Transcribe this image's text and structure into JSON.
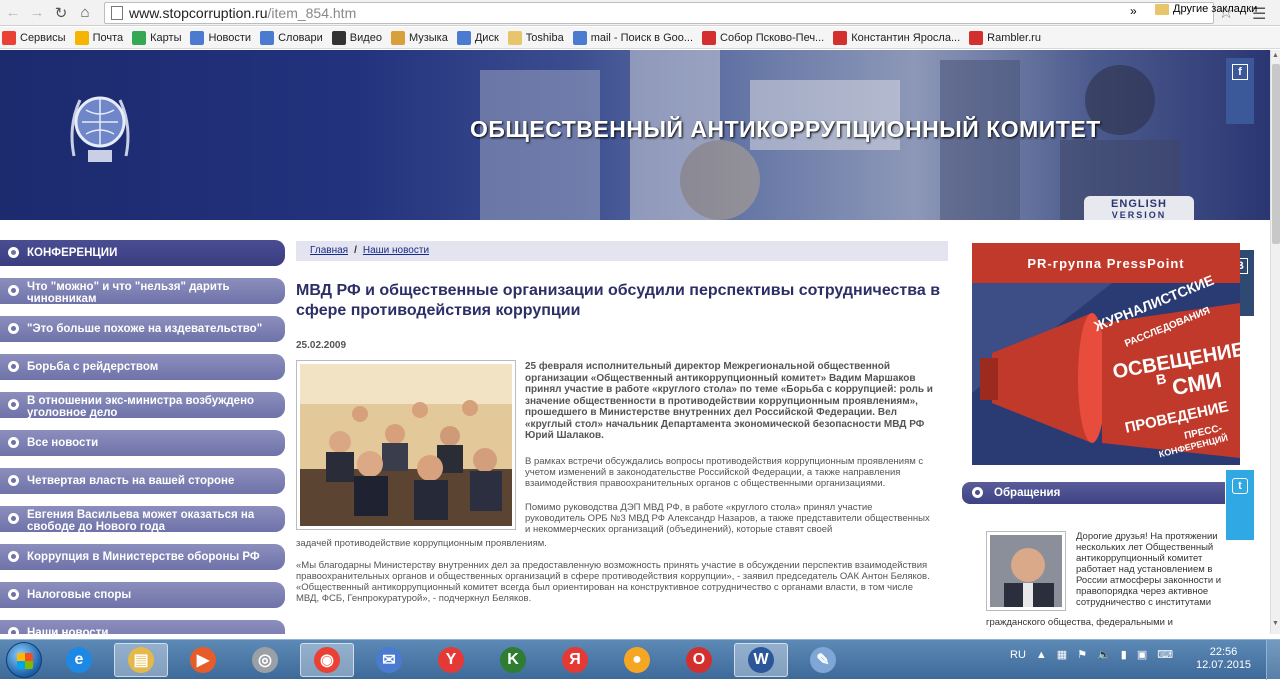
{
  "browser": {
    "url_host": "www.stopcorruption.ru",
    "url_path": "/item_854.htm",
    "bookmarks": [
      {
        "label": "Сервисы",
        "color": "#e94235"
      },
      {
        "label": "Почта",
        "color": "#f4b400"
      },
      {
        "label": "Карты",
        "color": "#34a853"
      },
      {
        "label": "Новости",
        "color": "#4a7bd0"
      },
      {
        "label": "Словари",
        "color": "#4a7bd0"
      },
      {
        "label": "Видео",
        "color": "#333333"
      },
      {
        "label": "Музыка",
        "color": "#d8a03a"
      },
      {
        "label": "Диск",
        "color": "#4a7bd0"
      },
      {
        "label": "Toshiba",
        "color": "#e8c46a"
      },
      {
        "label": "mail - Поиск в Goo...",
        "color": "#4a7bd0"
      },
      {
        "label": "Собор Псково-Печ...",
        "color": "#d32f2f"
      },
      {
        "label": "Константин Яросла...",
        "color": "#d32f2f"
      },
      {
        "label": "Rambler.ru",
        "color": "#d32f2f"
      }
    ],
    "bookmarks_more": "»",
    "bookmarks_other": "Другие закладки"
  },
  "header": {
    "title": "ОБЩЕСТВЕННЫЙ АНТИКОРРУПЦИОННЫЙ КОМИТЕТ",
    "english_line1": "ENGLISH",
    "english_line2": "VERSION",
    "social": {
      "facebook": "f",
      "vk": "B",
      "twitter": "t"
    }
  },
  "sidebar": {
    "items": [
      {
        "label": "КОНФЕРЕНЦИИ",
        "active": true
      },
      {
        "label": "Что \"можно\" и что \"нельзя\" дарить чиновникам",
        "active": false
      },
      {
        "label": "\"Это больше похоже на издевательство\"",
        "active": false
      },
      {
        "label": "Борьба с рейдерством",
        "active": false
      },
      {
        "label": "В отношении экс-министра возбуждено уголовное дело",
        "active": false
      },
      {
        "label": "Все новости",
        "active": false
      },
      {
        "label": "Четвертая власть на вашей стороне",
        "active": false
      },
      {
        "label": "Евгения Васильева может оказаться на свободе до Нового года",
        "active": false
      },
      {
        "label": "Коррупция в Министерстве обороны РФ",
        "active": false
      },
      {
        "label": "Налоговые споры",
        "active": false
      },
      {
        "label": "Наши новости",
        "active": false
      }
    ]
  },
  "article": {
    "breadcrumb_home": "Главная",
    "breadcrumb_sep": "/",
    "breadcrumb_current": "Наши новости",
    "title": "МВД РФ и общественные организации обсудили перспективы сотрудничества в сфере противодействия коррупции",
    "date": "25.02.2009",
    "lead": "25 февраля исполнительный директор Межрегиональной общественной организации «Общественный антикоррупционный комитет» Вадим Маршаков принял участие в работе «круглого стола» по теме «Борьба с коррупцией: роль и значение общественности в противодействии коррупционным проявлениям», прошедшего в Министерстве внутренних дел Российской Федерации. Вел «круглый стол» начальник Департамента экономической безопасности МВД РФ Юрий Шалаков.",
    "p1": "В рамках встречи обсуждались вопросы противодействия коррупционным проявлениям с учетом изменений в законодательстве Российской Федерации, а также направления взаимодействия правоохранительных органов с общественными организациями.",
    "p2a": "Помимо руководства ДЭП МВД РФ, в работе «круглого стола» принял участие руководитель ОРБ №3 МВД РФ Александр Назаров, а также представители общественных и некоммерческих организаций (объединений), которые ставят своей",
    "p2b": "задачей противодействие коррупционным проявлениям.",
    "p3": "«Мы благодарны Министерству внутренних дел за предоставленную возможность принять участие в обсуждении перспектив взаимодействия правоохранительных органов и общественных организаций в сфере противодействия коррупции», - заявил председатель ОАК Антон Беляков. «Общественный антикоррупционный комитет всегда был ориентирован на конструктивное сотрудничество с органами власти, в том числе МВД, ФСБ, Генпрокуратурой», - подчеркнул Беляков."
  },
  "right": {
    "promo_head": "PR-группа PressPoint",
    "promo_lines": [
      "ЖУРНАЛИСТСКИЕ",
      "РАССЛЕДОВАНИЯ",
      "ОСВЕЩЕНИЕ",
      "В",
      "СМИ",
      "ПРОВЕДЕНИЕ",
      "ПРЕСС-",
      "КОНФЕРЕНЦИЙ"
    ],
    "obr_label": "Обращения",
    "appeal_a": "Дорогие друзья! На протяжении нескольких лет Общественный антикоррупционный комитет работает над установлением в России атмосферы законности и правопорядка через активное сотрудничество с институтами",
    "appeal_b": "гражданского общества, федеральными и"
  },
  "taskbar": {
    "lang": "RU",
    "time": "22:56",
    "date": "12.07.2015",
    "apps": [
      "ie",
      "explorer",
      "media",
      "itunes",
      "chrome",
      "mail",
      "yandex-browser",
      "kaspersky",
      "yandex",
      "fruit",
      "opera",
      "word",
      "paint"
    ]
  },
  "colors": {
    "banner_dark": "#1c2a6e",
    "sidebar_item": "#6f72a8",
    "title_color": "#2c2f66",
    "promo_red": "#c1392b"
  }
}
